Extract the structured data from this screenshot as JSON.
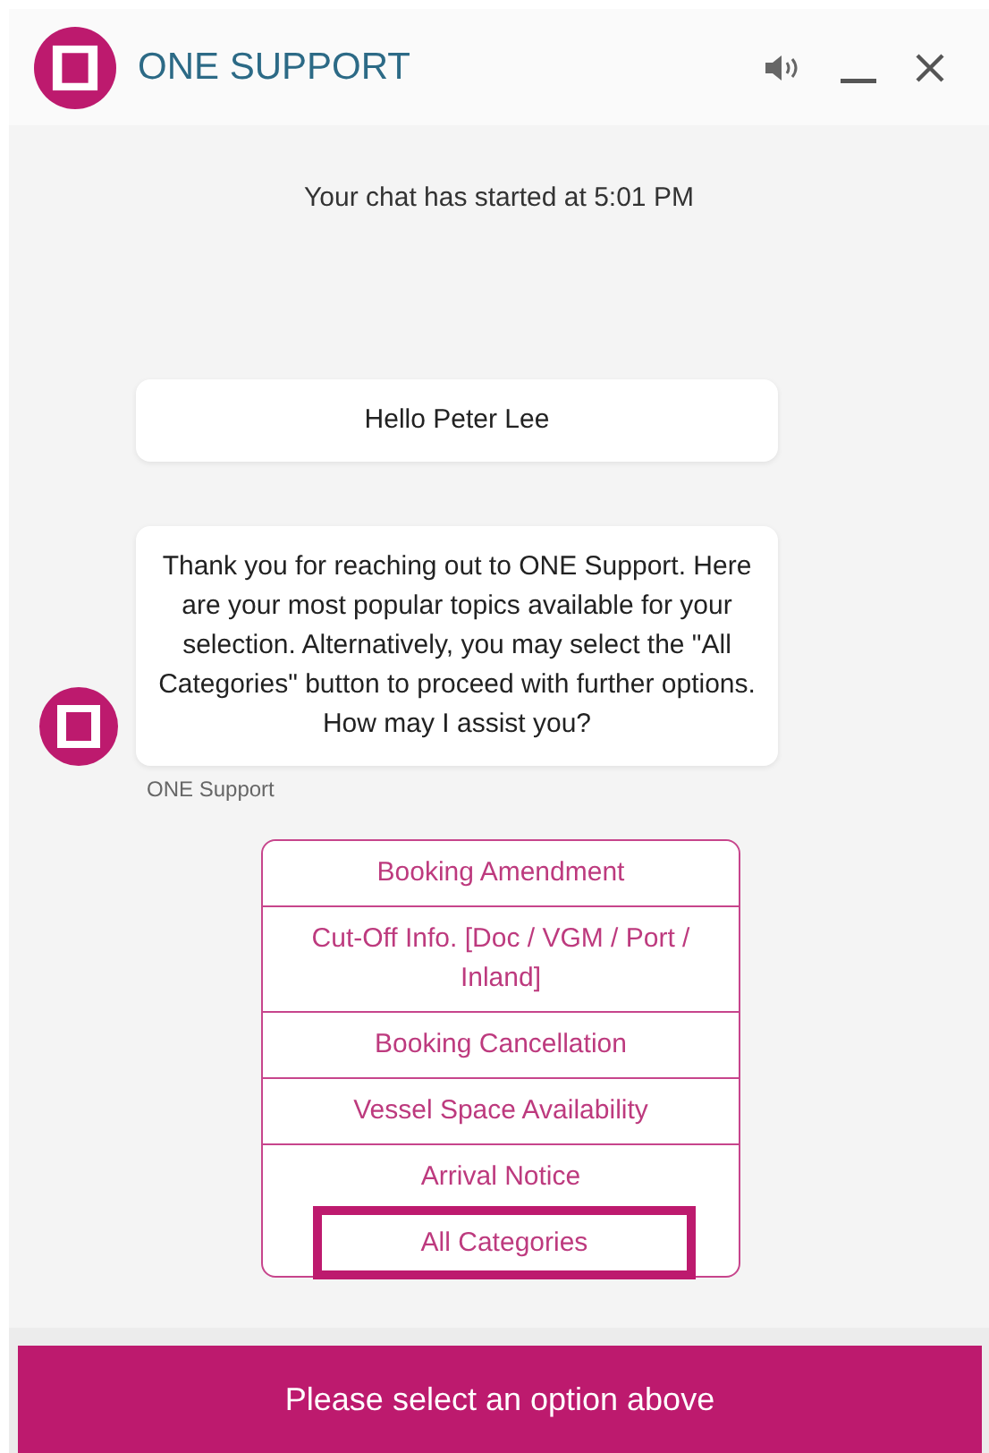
{
  "header": {
    "title": "ONE SUPPORT"
  },
  "chat": {
    "started": "Your chat has started at 5:01 PM",
    "messages": [
      {
        "kind": "plain",
        "text": "Hello Peter Lee"
      },
      {
        "kind": "bot",
        "text": "Thank you for reaching out to ONE Support. Here are your most popular topics available for your selection. Alternatively, you may select the \"All Categories\" button to proceed with further options. How may I assist you?",
        "sender": "ONE Support"
      }
    ],
    "options": [
      {
        "label": "Booking Amendment",
        "selected": false
      },
      {
        "label": "Cut-Off Info. [Doc / VGM / Port / Inland]",
        "selected": false
      },
      {
        "label": "Booking Cancellation",
        "selected": false
      },
      {
        "label": "Vessel Space Availability",
        "selected": false
      },
      {
        "label": "Arrival Notice",
        "selected": false
      },
      {
        "label": "All Categories",
        "selected": true
      }
    ]
  },
  "footer": {
    "prompt": "Please select an option above"
  }
}
